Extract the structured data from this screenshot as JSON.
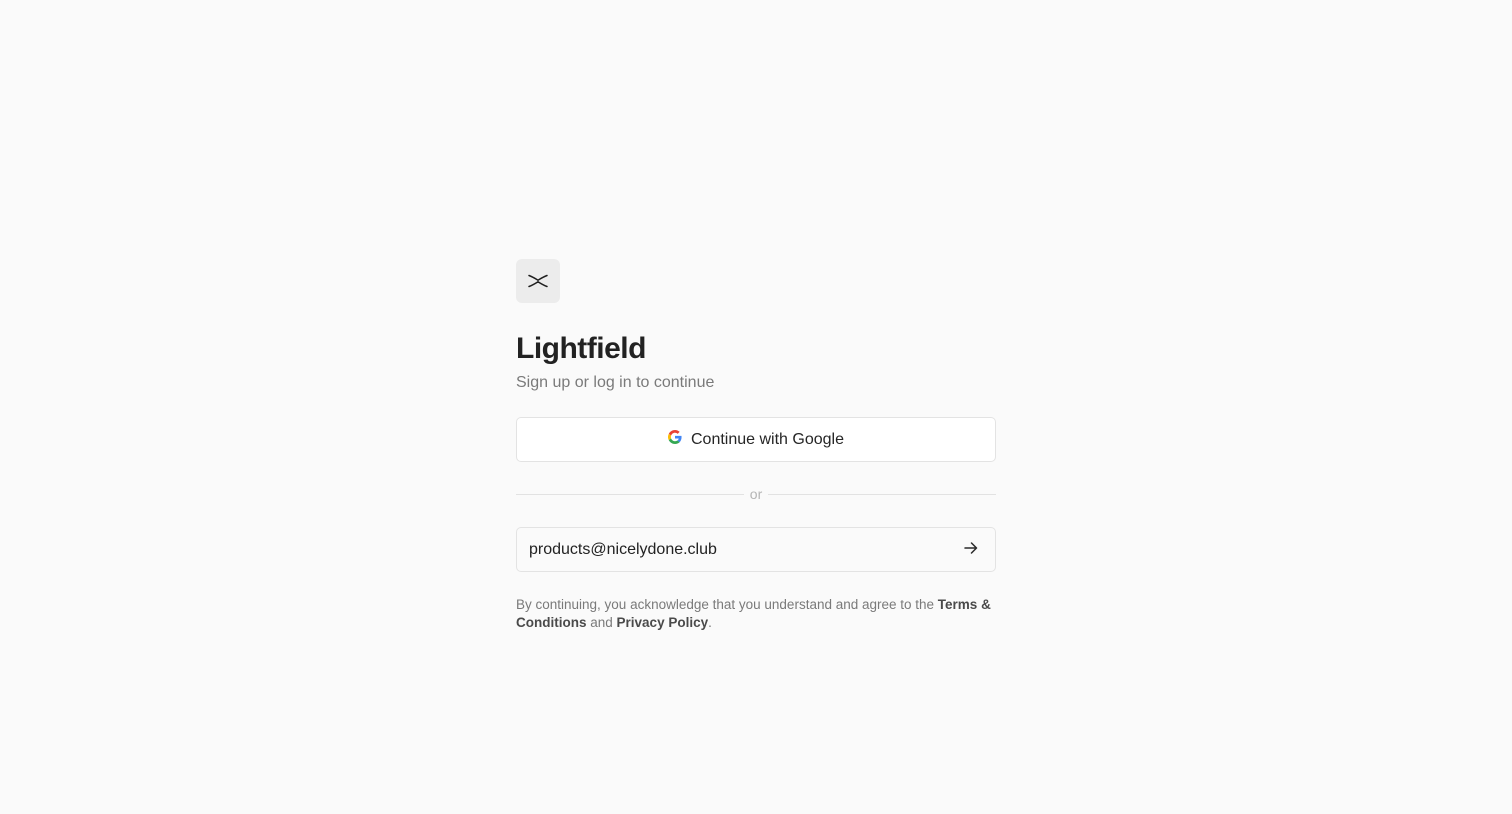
{
  "app": {
    "logo_icon": "butterfly-x-icon",
    "title": "Lightfield",
    "subtitle": "Sign up or log in to continue"
  },
  "auth": {
    "google_button_label": "Continue with Google",
    "google_icon": "google-g-icon",
    "divider_text": "or",
    "email_value": "products@nicelydone.club",
    "submit_icon": "arrow-right-icon"
  },
  "legal": {
    "prefix": "By continuing, you acknowledge that you understand and agree to the ",
    "terms_label": "Terms & Conditions",
    "middle": " and ",
    "privacy_label": "Privacy Policy",
    "suffix": "."
  },
  "colors": {
    "background": "#fafafa",
    "logo_tile": "#ececec",
    "border": "#e3e3e3",
    "muted_text": "#7a7a7a"
  }
}
